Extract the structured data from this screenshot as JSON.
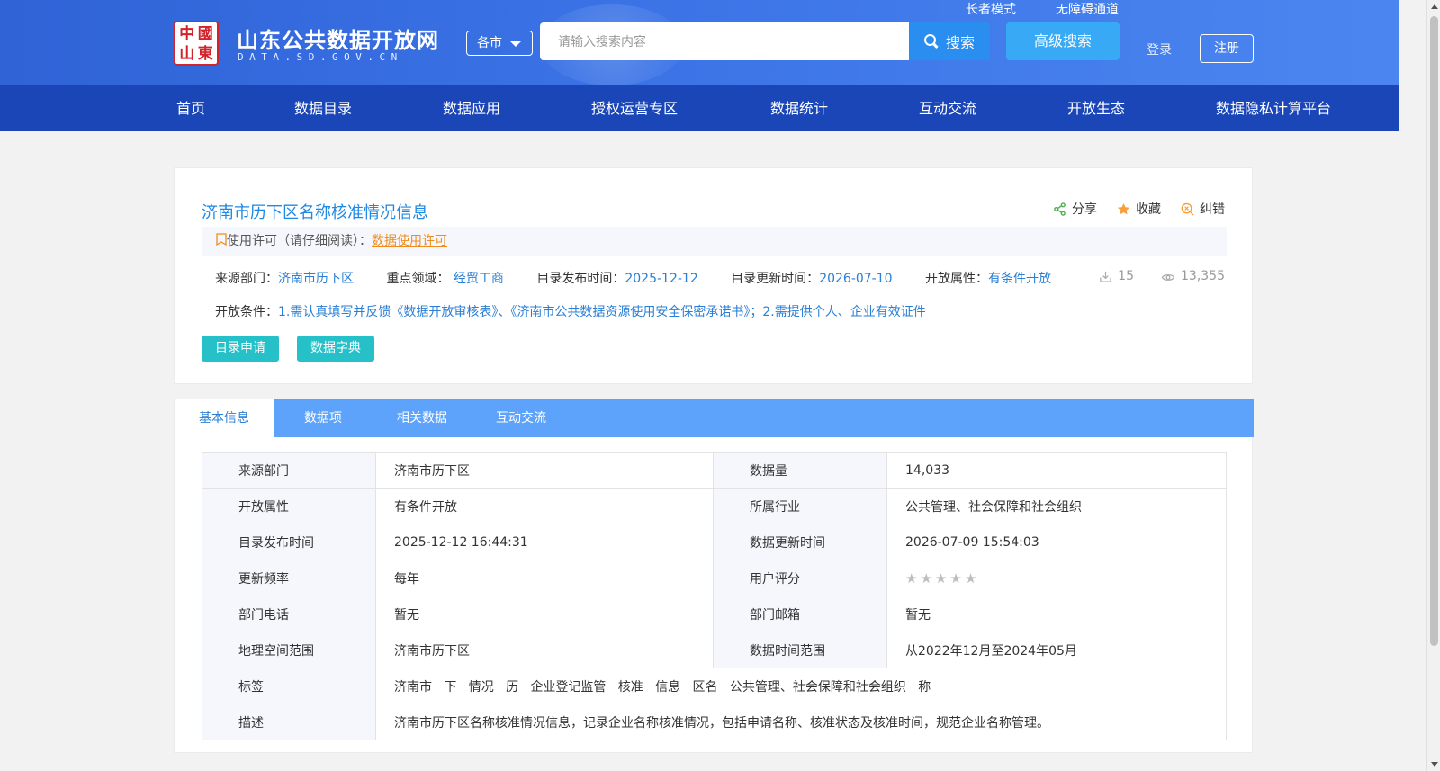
{
  "header": {
    "logo_seal_chars": [
      "中",
      "國",
      "山",
      "東"
    ],
    "site_name": "山东公共数据开放网",
    "site_domain": "DATA.SD.GOV.CN",
    "city_select": "各市",
    "search_placeholder": "请输入搜索内容",
    "search_button": "搜索",
    "advanced_search": "高级搜索",
    "elder_mode": "长者模式",
    "accessibility": "无障碍通道",
    "login": "登录",
    "register": "注册"
  },
  "nav": [
    "首页",
    "数据目录",
    "数据应用",
    "授权运营专区",
    "数据统计",
    "互动交流",
    "开放生态",
    "数据隐私计算平台"
  ],
  "dataset": {
    "title": "济南市历下区名称核准情况信息",
    "actions": {
      "share": "分享",
      "favorite": "收藏",
      "report_error": "纠错"
    },
    "license_label": "使用许可（请仔细阅读）：",
    "license_link": "数据使用许可",
    "meta": {
      "source_label": "来源部门：",
      "source_value": "济南市历下区",
      "domain_label": "重点领域：",
      "domain_value": "经贸工商",
      "publish_label": "目录发布时间：",
      "publish_value": "2025-12-12",
      "update_label": "目录更新时间：",
      "update_value": "2026-07-10",
      "open_label": "开放属性：",
      "open_value": "有条件开放"
    },
    "downloads": "15",
    "views": "13,355",
    "conditions_label": "开放条件：",
    "conditions_value": "1.需认真填写并反馈《数据开放审核表》、《济南市公共数据资源使用安全保密承诺书》；2.需提供个人、企业有效证件",
    "apply_button": "目录申请",
    "dictionary_button": "数据字典"
  },
  "tabs": [
    "基本信息",
    "数据项",
    "相关数据",
    "互动交流"
  ],
  "info_table": {
    "rows": [
      {
        "k1": "来源部门",
        "v1": "济南市历下区",
        "k2": "数据量",
        "v2": "14,033"
      },
      {
        "k1": "开放属性",
        "v1": "有条件开放",
        "k2": "所属行业",
        "v2": "公共管理、社会保障和社会组织"
      },
      {
        "k1": "目录发布时间",
        "v1": "2025-12-12 16:44:31",
        "k2": "数据更新时间",
        "v2": "2026-07-09 15:54:03"
      },
      {
        "k1": "更新频率",
        "v1": "每年",
        "k2": "用户评分",
        "v2": ""
      },
      {
        "k1": "部门电话",
        "v1": "暂无",
        "k2": "部门邮箱",
        "v2": "暂无"
      },
      {
        "k1": "地理空间范围",
        "v1": "济南市历下区",
        "k2": "数据时间范围",
        "v2": "从2022年12月至2024年05月"
      }
    ],
    "tags_label": "标签",
    "tags": [
      "济南市",
      "下",
      "情况",
      "历",
      "企业登记监管",
      "核准",
      "信息",
      "区名",
      "公共管理、社会保障和社会组织",
      "称"
    ],
    "desc_label": "描述",
    "desc_value": "济南市历下区名称核准情况信息，记录企业名称核准情况，包括申请名称、核准状态及核准时间，规范企业名称管理。",
    "user_rating": 0,
    "rating_max": 5
  },
  "colors": {
    "header_blue": "#3b73e6",
    "nav_blue": "#1a46b8",
    "link_blue": "#2a7fd4",
    "teal": "#26c0c9",
    "tab_blue": "#5ea3fb",
    "license_orange": "#f08c1e"
  }
}
